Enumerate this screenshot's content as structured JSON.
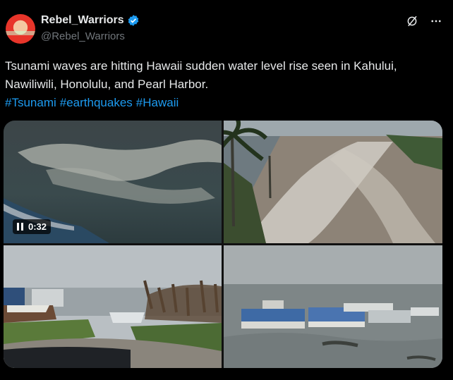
{
  "author": {
    "display_name": "Rebel_Warriors",
    "handle": "@Rebel_Warriors",
    "verified": true
  },
  "tweet": {
    "text": "Tsunami waves are hitting Hawaii  sudden water level rise seen in Kahului, Nawiliwili, Honolulu, and Pearl Harbor.",
    "hashtags": [
      "#Tsunami",
      "#earthquakes",
      "#Hawaii"
    ]
  },
  "media": {
    "video_time": "0:32"
  },
  "icons": {
    "verified": "verified-badge-icon",
    "grok": "grok-icon",
    "more": "more-icon",
    "pause": "pause-icon"
  },
  "colors": {
    "background": "#000000",
    "text": "#e7e9ea",
    "secondary_text": "#71767b",
    "link": "#1d9bf0"
  }
}
